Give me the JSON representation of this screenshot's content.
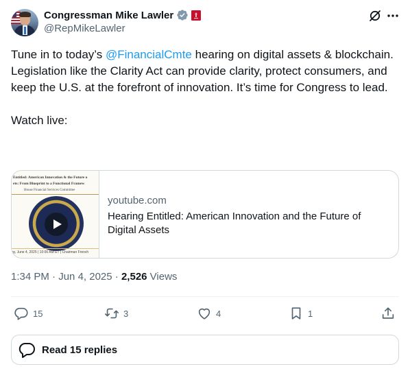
{
  "author": {
    "display_name": "Congressman Mike Lawler",
    "handle": "@RepMikeLawler"
  },
  "tweet": {
    "line1_pre": "Tune in to today’s ",
    "mention": "@FinancialCmte",
    "line1_post": " hearing on digital assets & blockchain.",
    "line2": "Legislation like the Clarity Act can provide clarity, protect consumers, and keep the U.S. at the forefront of innovation. It’s time for Congress to lead.",
    "line3": "Watch live:"
  },
  "card": {
    "domain": "youtube.com",
    "title": "Hearing Entitled: American Innovation and the Future of Digital Assets",
    "thumb_title_line1": "Entitled: American Innovation & the Future o",
    "thumb_title_line2": "ets: From Blueprint to a Functional Framew",
    "thumb_subtitle": "House Financial Services Committee",
    "thumb_footer": "ay, June 4, 2025  |  10:00 AM ET  |  Chairman French"
  },
  "meta": {
    "time": "1:34 PM",
    "separator": " · ",
    "date": "Jun 4, 2025",
    "views_count": "2,526",
    "views_label": " Views"
  },
  "actions": {
    "replies": "15",
    "reposts": "3",
    "likes": "4",
    "bookmarks": "1"
  },
  "read_replies": {
    "label": "Read 15 replies"
  },
  "colors": {
    "accent": "#1d9bf0",
    "muted": "#536471",
    "border": "#cfd9de",
    "verified_badge": "#829aab",
    "affiliation_badge": "#c8102e"
  },
  "icons": {
    "verified": "verified-badge-icon",
    "affiliation": "government-affiliation-icon",
    "grok": "grok-icon",
    "more": "more-icon",
    "play": "play-icon",
    "reply": "reply-icon",
    "repost": "repost-icon",
    "like": "like-icon",
    "bookmark": "bookmark-icon",
    "share": "share-icon",
    "replies_bubble": "replies-bubble-icon"
  }
}
